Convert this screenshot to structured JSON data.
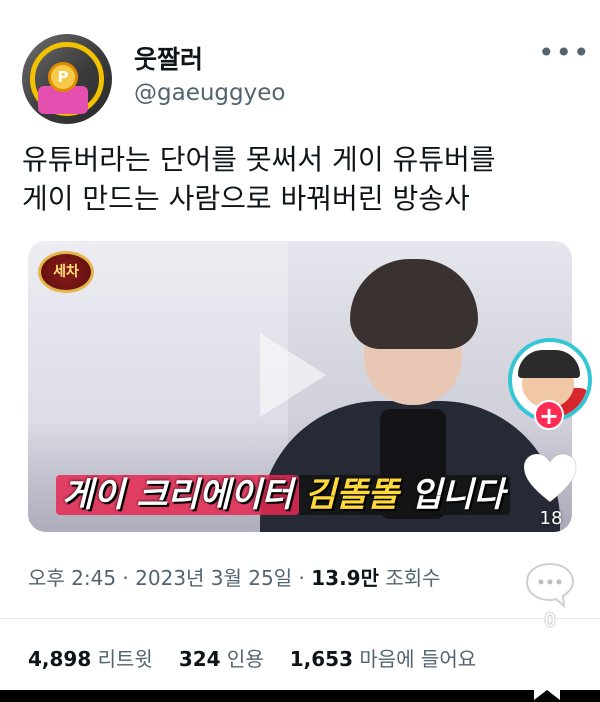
{
  "author": {
    "display_name": "웃짤러",
    "handle": "@gaeuggyeo",
    "avatar_icon": "coin-gift-icon"
  },
  "more_label": "•••",
  "tweet": {
    "line1": "유튜버라는 단어를 못써서 게이 유튜버를",
    "line2": "게이 만드는 사람으로 바꿔버린 방송사"
  },
  "media": {
    "show_logo": "세차",
    "caption_part1": "게이 크리에이터",
    "caption_part2": "김똘똘",
    "caption_part3": "입니다",
    "like_count": "18",
    "comment_count": "0",
    "follow_symbol": "+"
  },
  "meta": {
    "time": "오후 2:45",
    "sep1": " · ",
    "date": "2023년 3월 25일",
    "sep2": " · ",
    "views_value": "13.9만",
    "views_label": " 조회수"
  },
  "stats": {
    "retweets_value": "4,898",
    "retweets_label": " 리트윗",
    "quotes_value": "324",
    "quotes_label": " 인용",
    "likes_value": "1,653",
    "likes_label": " 마음에 들어요"
  },
  "colors": {
    "accent_pink": "#fe2c55",
    "ring_cyan": "#34c6d4",
    "caption_yellow": "#ffd93b",
    "muted_text": "#536471"
  }
}
